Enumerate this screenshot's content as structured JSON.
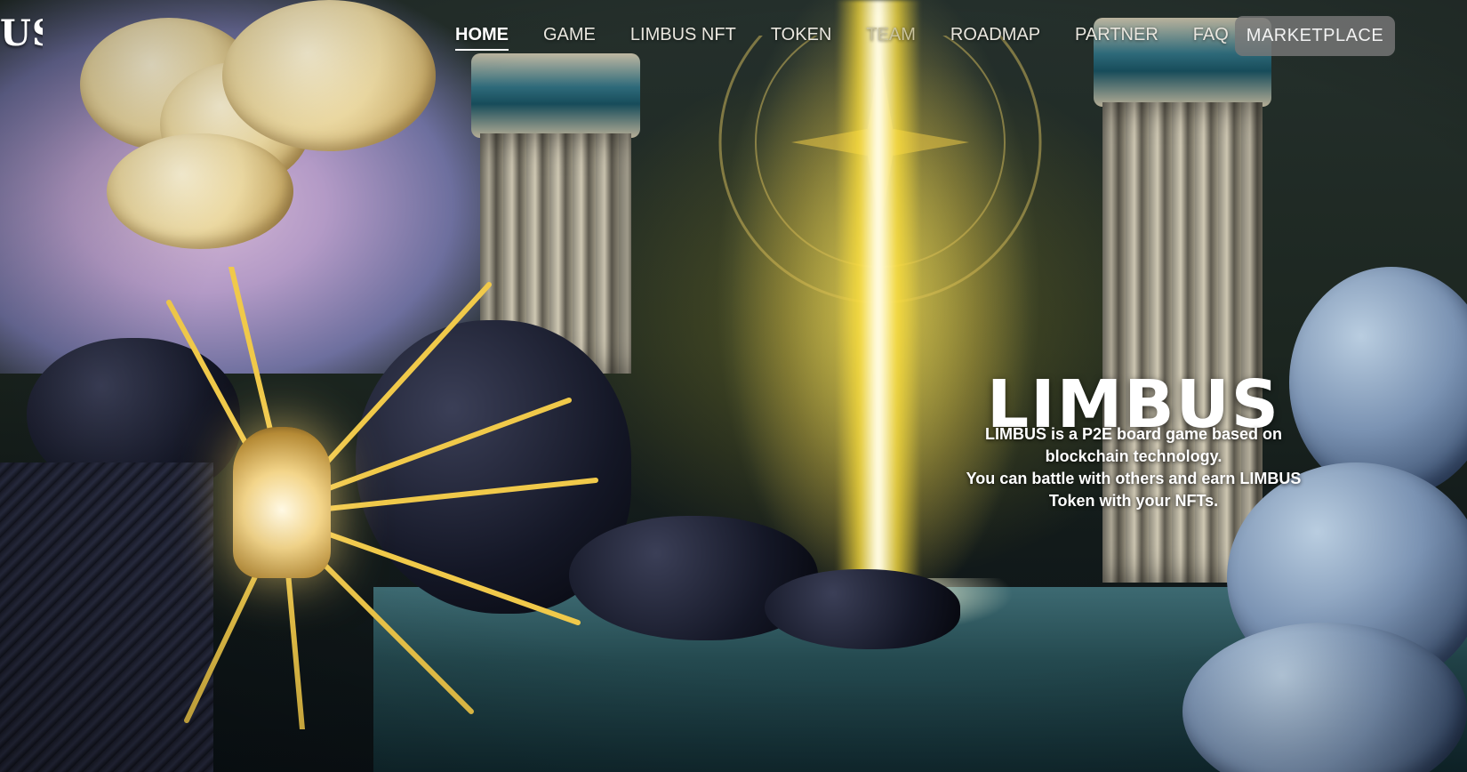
{
  "brand": {
    "logo_text": "US"
  },
  "nav": {
    "items": [
      {
        "label": "HOME",
        "active": true
      },
      {
        "label": "GAME",
        "active": false
      },
      {
        "label": "LIMBUS NFT",
        "active": false
      },
      {
        "label": "TOKEN",
        "active": false
      },
      {
        "label": "TEAM",
        "active": false
      },
      {
        "label": "ROADMAP",
        "active": false
      },
      {
        "label": "PARTNER",
        "active": false
      },
      {
        "label": "FAQ",
        "active": false
      }
    ],
    "marketplace_label": "MARKETPLACE"
  },
  "hero": {
    "title": "LIMBUS",
    "description_lines": [
      "LIMBUS is a P2E board game based on blockchain technology.",
      "You can battle with others and earn LIMBUS Token with your NFTs."
    ]
  },
  "colors": {
    "beam": "#fffbe0",
    "sea": "#24494f",
    "button_bg": "#787878"
  }
}
